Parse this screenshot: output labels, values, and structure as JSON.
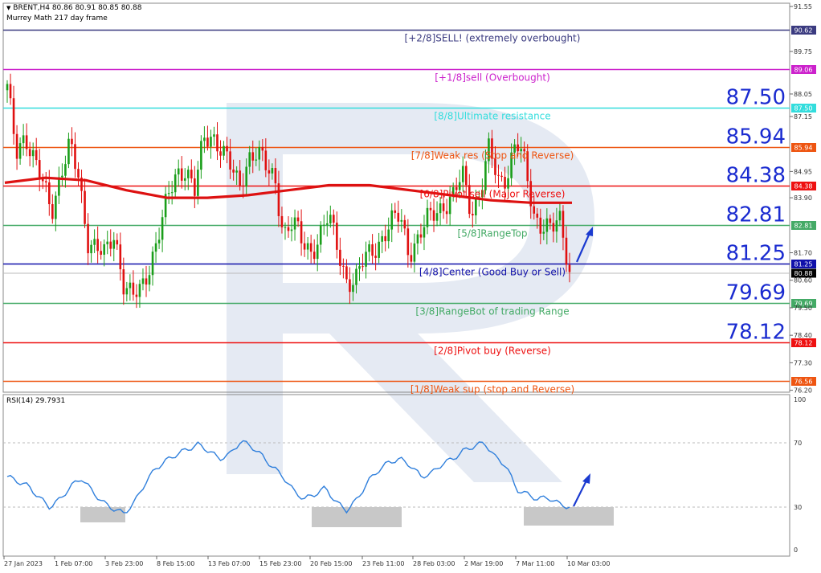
{
  "header": {
    "symbol_line": "BRENT,H4  80.86 80.91 80.85 80.88",
    "indicator_line": "Murrey Math 217 day frame"
  },
  "rsi_header": "RSI(14) 29.7931",
  "watermark_letter": "R",
  "colors": {
    "bull": "#1a9e1a",
    "bear": "#e01010",
    "ma": "#dd1111",
    "rsi": "#2f7fdc",
    "arrow": "#1a3ad0",
    "zone": "#c8c8c8"
  },
  "chart_data": [
    {
      "type": "line",
      "title": "BRENT,H4",
      "ylim": [
        75.6,
        91.8
      ],
      "y_ticks": [
        "91.55",
        "90.62",
        "89.75",
        "89.06",
        "88.05",
        "87.50",
        "87.15",
        "85.94",
        "84.95",
        "84.38",
        "83.90",
        "82.81",
        "81.70",
        "81.25",
        "80.88",
        "80.60",
        "79.69",
        "79.50",
        "78.40",
        "78.12",
        "77.30",
        "76.56",
        "76.20"
      ],
      "x_ticks": [
        "27 Jan 2023",
        "1 Feb 07:00",
        "3 Feb 23:00",
        "8 Feb 15:00",
        "13 Feb 07:00",
        "15 Feb 23:00",
        "20 Feb 15:00",
        "23 Feb 11:00",
        "28 Feb 03:00",
        "2 Mar 19:00",
        "7 Mar 11:00",
        "10 Mar 03:00"
      ],
      "current_price": "80.88",
      "murrey_levels": [
        {
          "value": 90.62,
          "tag": "90.62",
          "label": "[+2/8]SELL! (extremely overbought)",
          "big": "",
          "color": "#3b3b80"
        },
        {
          "value": 89.06,
          "tag": "89.06",
          "label": "[+1/8]sell (Overbought)",
          "big": "",
          "color": "#cc22cc"
        },
        {
          "value": 87.5,
          "tag": "87.50",
          "label": "[8/8]Ultimate resistance",
          "big": "87.50",
          "color": "#33dddd"
        },
        {
          "value": 85.94,
          "tag": "85.94",
          "label": "[7/8]Weak res (Stop and Reverse)",
          "big": "85.94",
          "color": "#ee5511"
        },
        {
          "value": 84.38,
          "tag": "84.38",
          "label": "[6/8]Pivot sell (Major Reverse)",
          "big": "84.38",
          "color": "#ee1111"
        },
        {
          "value": 82.81,
          "tag": "82.81",
          "label": "[5/8]RangeTop",
          "big": "82.81",
          "color": "#44aa66"
        },
        {
          "value": 81.25,
          "tag": "81.25",
          "label": "[4/8]Center (Good Buy or Sell)",
          "big": "81.25",
          "color": "#1111aa"
        },
        {
          "value": 79.69,
          "tag": "79.69",
          "label": "[3/8]RangeBot of trading Range",
          "big": "79.69",
          "color": "#44aa66"
        },
        {
          "value": 78.12,
          "tag": "78.12",
          "label": "[2/8]Pivot buy (Reverse)",
          "big": "78.12",
          "color": "#ee1111"
        },
        {
          "value": 76.56,
          "tag": "76.56",
          "label": "[1/8]Weak sup (stop and Reverse)",
          "big": "",
          "color": "#ee5511"
        }
      ],
      "price_path": [
        88.2,
        85.8,
        86.5,
        85.3,
        84.4,
        83.5,
        84.9,
        85.9,
        84.7,
        82.3,
        81.9,
        81.5,
        82.5,
        80.6,
        79.9,
        80.1,
        81.3,
        82.6,
        83.8,
        84.8,
        85.2,
        84.2,
        86.1,
        86.4,
        86.0,
        85.1,
        84.2,
        85.6,
        85.8,
        85.0,
        84.6,
        82.5,
        82.9,
        82.1,
        81.8,
        82.4,
        83.1,
        81.9,
        80.7,
        80.5,
        81.4,
        81.9,
        82.3,
        82.8,
        83.2,
        81.8,
        82.2,
        82.9,
        83.4,
        83.7,
        83.9,
        84.8,
        83.4,
        84.2,
        85.8,
        84.5,
        84.9,
        86.2,
        85.1,
        83.2,
        82.9,
        82.6,
        82.9,
        81.0
      ],
      "moving_average": [
        84.5,
        84.7,
        84.6,
        84.2,
        83.9,
        83.9,
        84.0,
        84.2,
        84.4,
        84.4,
        84.2,
        84.0,
        83.8,
        83.7,
        83.7
      ],
      "annotation": "projected rise from 81.0"
    },
    {
      "type": "line",
      "title": "RSI(14) 29.7931",
      "ylim": [
        0,
        100
      ],
      "y_ticks": [
        "100",
        "70",
        "30",
        "0"
      ],
      "levels": [
        70,
        30
      ],
      "values": [
        49,
        46,
        43,
        36,
        30,
        35,
        43,
        48,
        40,
        33,
        29,
        26,
        33,
        45,
        54,
        59,
        63,
        66,
        69,
        65,
        60,
        63,
        71,
        68,
        62,
        55,
        49,
        40,
        35,
        38,
        42,
        33,
        28,
        35,
        46,
        53,
        58,
        60,
        56,
        49,
        51,
        57,
        60,
        65,
        68,
        70,
        61,
        56,
        41,
        38,
        35,
        36,
        32,
        30
      ],
      "oversold_zones": [
        "3 Feb 23:00",
        "20 Feb 15:00",
        "10 Mar 03:00"
      ]
    }
  ]
}
